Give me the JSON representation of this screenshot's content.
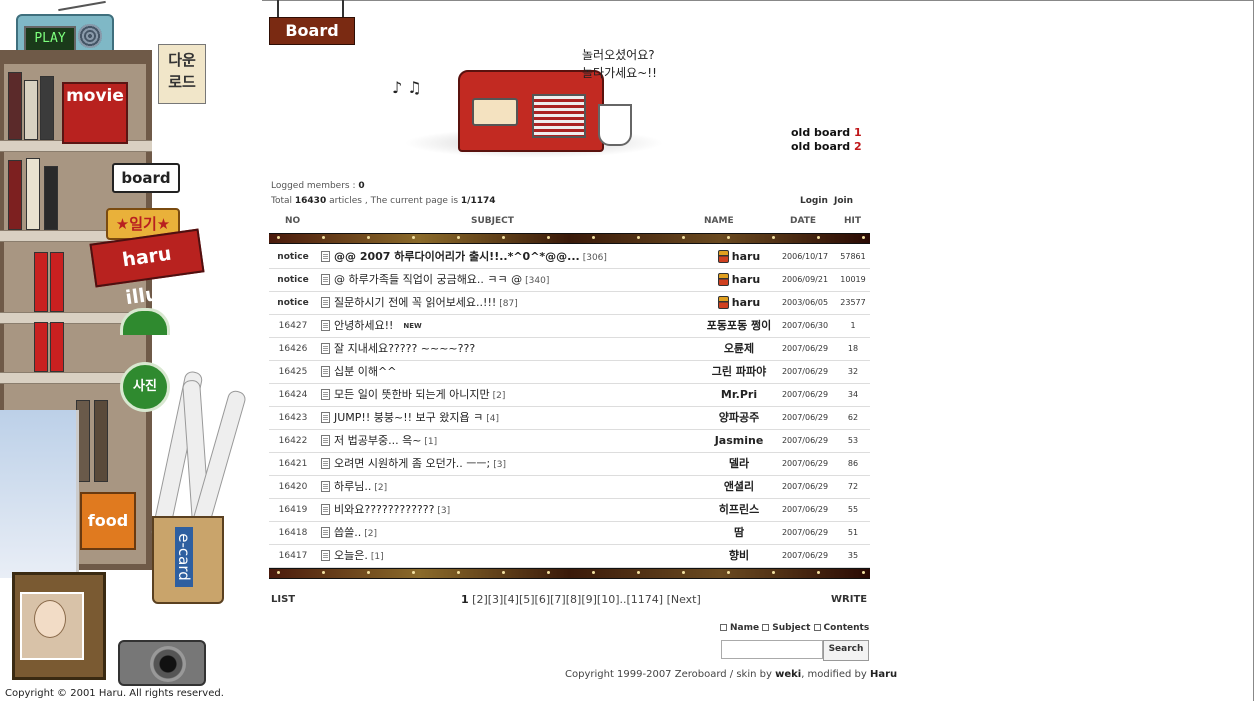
{
  "sidebar": {
    "radio_label": "PLAY",
    "download_label": "다운\n로드",
    "movie_label": "movie",
    "board_label": "board",
    "diary_label": "★일기★",
    "illust_label": "haru illust",
    "photo_label": "사진",
    "food_label": "food",
    "ecard_label": "e-card",
    "copyright": "Copyright © 2001 Haru. All rights reserved."
  },
  "header": {
    "board_title": "Board",
    "speech_line1": "놀러오셨어요?",
    "speech_line2": "놀다가세요~!!",
    "old_board_text": "old board",
    "old_board_1": "1",
    "old_board_2": "2"
  },
  "status": {
    "logged_label": "Logged members : ",
    "logged_count": "0",
    "total_label": "Total ",
    "total_count": "16430",
    "articles_label": " articles , The current page is ",
    "page_info": "1/1174",
    "login_label": "Login",
    "join_label": "Join"
  },
  "columns": {
    "no": "NO",
    "subject": "SUBJECT",
    "name": "NAME",
    "date": "DATE",
    "hit": "HIT"
  },
  "rows": [
    {
      "no": "notice",
      "subject": "@@ 2007 하루다이어리가 출시!!..*^0^*@@...",
      "comments": "[306]",
      "name": "haru",
      "date": "2006/10/17",
      "hit": "57861",
      "notice": true,
      "member": true,
      "bold": true
    },
    {
      "no": "notice",
      "subject": "@ 하루가족들 직업이 궁금해요.. ㅋㅋ @",
      "comments": "[340]",
      "name": "haru",
      "date": "2006/09/21",
      "hit": "10019",
      "notice": true,
      "member": true
    },
    {
      "no": "notice",
      "subject": "질문하시기 전에 꼭 읽어보세요..!!!",
      "comments": "[87]",
      "name": "haru",
      "date": "2003/06/05",
      "hit": "23577",
      "notice": true,
      "member": true
    },
    {
      "no": "16427",
      "subject": "안녕하세요!!",
      "comments": "",
      "name": "포동포동 쩡이",
      "date": "2007/06/30",
      "hit": "1",
      "new": "NEW"
    },
    {
      "no": "16426",
      "subject": "잘 지내세요????? ~~~~???",
      "comments": "",
      "name": "오륜제",
      "date": "2007/06/29",
      "hit": "18"
    },
    {
      "no": "16425",
      "subject": "십분 이해^^",
      "comments": "",
      "name": "그린 파파야",
      "date": "2007/06/29",
      "hit": "32"
    },
    {
      "no": "16424",
      "subject": "모든 일이 뜻한바 되는게 아니지만",
      "comments": "[2]",
      "name": "Mr.Pri",
      "date": "2007/06/29",
      "hit": "34"
    },
    {
      "no": "16423",
      "subject": "JUMP!! 붕붕~!! 보구 왔지욥 ㅋ",
      "comments": "[4]",
      "name": "양파공주",
      "date": "2007/06/29",
      "hit": "62"
    },
    {
      "no": "16422",
      "subject": "저 법공부중... 윽~",
      "comments": "[1]",
      "name": "Jasmine",
      "date": "2007/06/29",
      "hit": "53"
    },
    {
      "no": "16421",
      "subject": "오려면 시원하게 좀 오던가.. ㅡㅡ;",
      "comments": "[3]",
      "name": "델라",
      "date": "2007/06/29",
      "hit": "86"
    },
    {
      "no": "16420",
      "subject": "하루님..",
      "comments": "[2]",
      "name": "앤셜리",
      "date": "2007/06/29",
      "hit": "72"
    },
    {
      "no": "16419",
      "subject": "비와요????????????",
      "comments": "[3]",
      "name": "히프린스",
      "date": "2007/06/29",
      "hit": "55"
    },
    {
      "no": "16418",
      "subject": "씁쓸..",
      "comments": "[2]",
      "name": "땀",
      "date": "2007/06/29",
      "hit": "51"
    },
    {
      "no": "16417",
      "subject": "오늘은.",
      "comments": "[1]",
      "name": "향비",
      "date": "2007/06/29",
      "hit": "35"
    }
  ],
  "footer": {
    "list_label": "LIST",
    "write_label": "WRITE",
    "current_page": "1",
    "pages": [
      "[2]",
      "[3]",
      "[4]",
      "[5]",
      "[6]",
      "[7]",
      "[8]",
      "[9]",
      "[10]",
      "..",
      "[1174]",
      " [Next]"
    ],
    "filter_name": "Name",
    "filter_subject": "Subject",
    "filter_contents": "Contents",
    "search_value": "",
    "search_label": "Search",
    "copyright_prefix": "Copyright 1999-2007 Zeroboard / skin by ",
    "skin_author": "weki",
    "modified_prefix": ", modified by ",
    "modifier": "Haru"
  }
}
